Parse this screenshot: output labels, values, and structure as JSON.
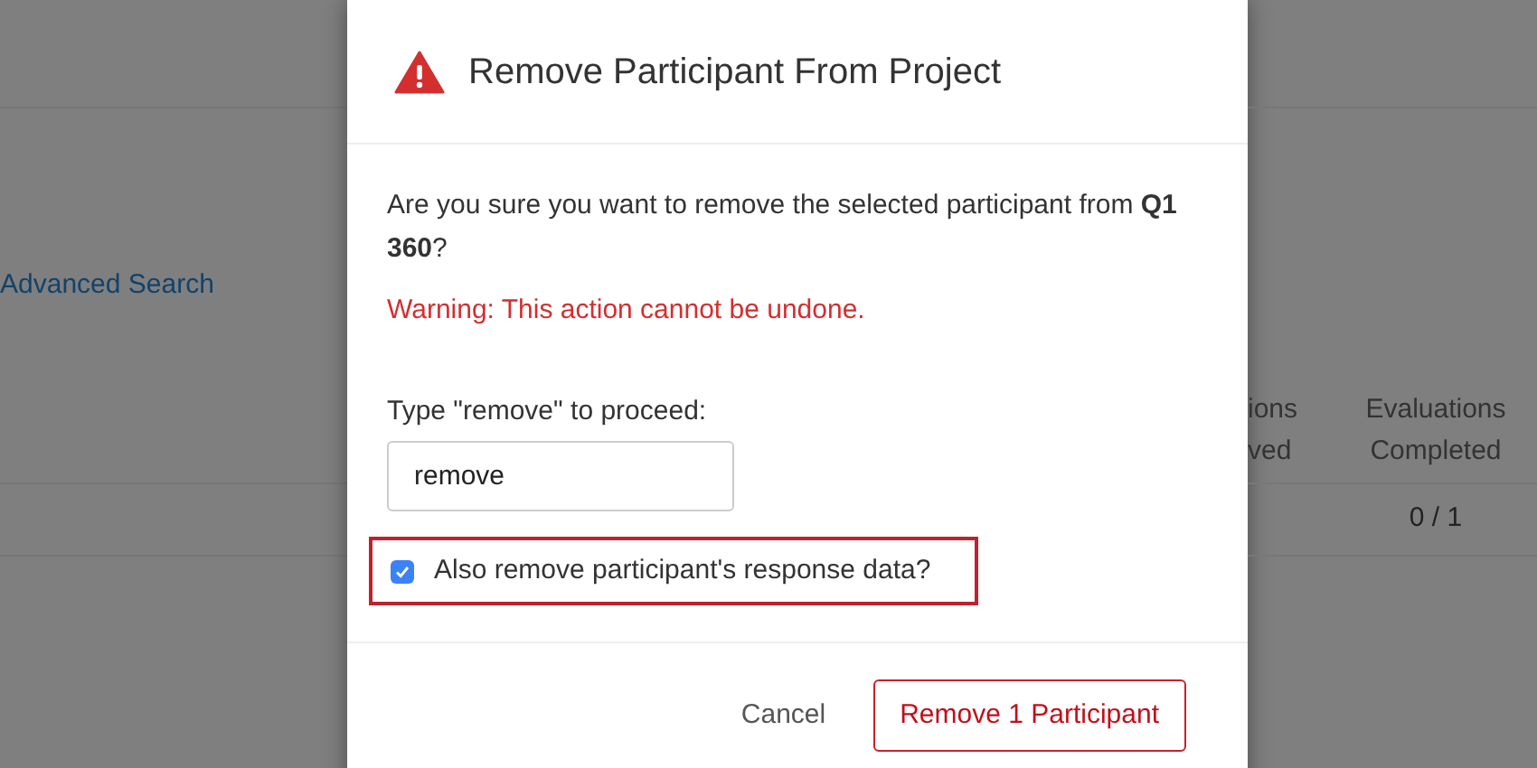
{
  "background": {
    "link": "Advanced Search",
    "table": {
      "columns": [
        "ions ved",
        "Evaluations Completed"
      ],
      "rows": [
        {
          "evaluations_completed": "0 / 1"
        }
      ]
    }
  },
  "dialog": {
    "title": "Remove Participant From Project",
    "message": "Are you sure you want to remove the selected participant from **Q1 360**?",
    "warning": "Warning: This action cannot be undone.",
    "prompt_label": "Type \"remove\" to proceed:",
    "input": {
      "value": "remove"
    },
    "checkbox": {
      "label": "Also remove participant's response data?",
      "checked": true,
      "highlighted": true
    },
    "buttons": [
      {
        "kind": "secondary",
        "label": "Cancel"
      },
      {
        "kind": "danger",
        "label": "Remove 1 Participant"
      }
    ]
  }
}
